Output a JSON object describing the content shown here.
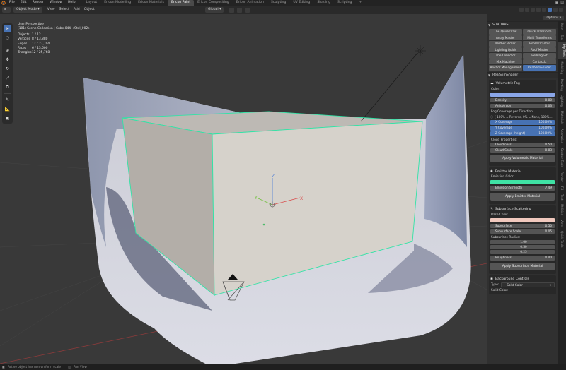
{
  "top_menu": [
    "File",
    "Edit",
    "Render",
    "Window",
    "Help"
  ],
  "workspace_tabs": [
    {
      "label": "Layout",
      "active": false
    },
    {
      "label": "Ericon Modelling",
      "active": false
    },
    {
      "label": "Ericon Materials",
      "active": false
    },
    {
      "label": "Ericon Paint",
      "active": true
    },
    {
      "label": "Ericon Compositing",
      "active": false
    },
    {
      "label": "Ericon Animation",
      "active": false
    },
    {
      "label": "Sculpting",
      "active": false
    },
    {
      "label": "UV Editing",
      "active": false
    },
    {
      "label": "Shading",
      "active": false
    },
    {
      "label": "Scripting",
      "active": false
    },
    {
      "label": "+",
      "active": false
    }
  ],
  "header": {
    "mode": "Object Mode",
    "menus": [
      "View",
      "Select",
      "Add",
      "Object"
    ],
    "transform_orientation": "Global",
    "options": "Options"
  },
  "viewport_overlay": {
    "view": "User Perspective",
    "collection": "(101) Scene Collection | Cube.044 <Stel_002>",
    "stats": [
      {
        "k": "Objects",
        "v": "1 / 12"
      },
      {
        "k": "Vertices",
        "v": "8 / 13,880"
      },
      {
        "k": "Edges",
        "v": "12 / 27,704"
      },
      {
        "k": "Faces",
        "v": "6 / 13,600"
      },
      {
        "k": "Triangles",
        "v": "12 / 25,768"
      }
    ],
    "gizmo_axes": {
      "z": "Z",
      "y": "Y",
      "x": "X"
    }
  },
  "tools": [
    "cursor",
    "select-box",
    "cursor-3d",
    "move",
    "rotate",
    "scale",
    "transform",
    "annotate",
    "measure",
    "add-cube"
  ],
  "sub_tabs": {
    "title": "SUB TABS",
    "buttons": [
      {
        "label": "The QuickDraw",
        "active": false
      },
      {
        "label": "Quick Transform",
        "active": false
      },
      {
        "label": "Array Master",
        "active": false
      },
      {
        "label": "Multi Transforms",
        "active": false
      },
      {
        "label": "Mother Picker",
        "active": false
      },
      {
        "label": "BoolsIDcanfor",
        "active": false
      },
      {
        "label": "Lighting Quick",
        "active": false
      },
      {
        "label": "Roof Master",
        "active": false
      },
      {
        "label": "The Collector",
        "active": false
      },
      {
        "label": "RefMagnet",
        "active": false
      },
      {
        "label": "Mix Machine",
        "active": false
      },
      {
        "label": "Cantactic",
        "active": false
      },
      {
        "label": "Anchor Management",
        "active": false
      },
      {
        "label": "RealSlimShader",
        "active": true
      }
    ]
  },
  "real_slim_shader": {
    "title": "RealSlimShader",
    "volumetric_fog": {
      "title": "Volumetric Fog",
      "color_label": "Color:",
      "color": "#8aa6e8",
      "fields": [
        {
          "label": "Density",
          "value": "0.80"
        },
        {
          "label": "Anisotropy",
          "value": "0.03"
        }
      ],
      "coverage_label": "Fog Coverage per Direction:",
      "coverage_note": "(-100% = Reverse, 0% = None, 100% ...",
      "coverage": [
        {
          "label": "X Coverage",
          "value": "100.00%"
        },
        {
          "label": "Y Coverage",
          "value": "100.00%"
        },
        {
          "label": "Z Coverage (height)",
          "value": "100.00%"
        }
      ],
      "cloud_label": "Cloud Properties:",
      "cloud": [
        {
          "label": "Cloudiness",
          "value": "0.50"
        },
        {
          "label": "Cloud Scale",
          "value": "0.83"
        }
      ],
      "apply": "Apply Volumetric Material"
    },
    "emitter": {
      "title": "Emitter Material",
      "color_label": "Emission Color:",
      "color": "#3fe2a4",
      "strength_label": "Emission Strength",
      "strength": "7.49",
      "apply": "Apply Emitter Material"
    },
    "subsurface": {
      "title": "Subsurface Scattering",
      "base_label": "Base Color:",
      "color": "#f0c8bd",
      "fields": [
        {
          "label": "Subsurface",
          "value": "0.50"
        },
        {
          "label": "Subsurface Scale",
          "value": "0.05"
        }
      ],
      "radius_label": "Subsurface Radius:",
      "radius": [
        "1.00",
        "0.50",
        "0.25"
      ],
      "roughness_label": "Roughness",
      "roughness": "0.40",
      "apply": "Apply Subsurface Material"
    },
    "background": {
      "title": "Background Controls",
      "type_label": "Type:",
      "type_value": "Solid Color",
      "solid_label": "Solid Color:"
    }
  },
  "vertical_tabs": [
    {
      "label": "Item",
      "active": false
    },
    {
      "label": "Tool",
      "active": false
    },
    {
      "label": "My Tools",
      "active": true
    },
    {
      "label": "Modeling",
      "active": false
    },
    {
      "label": "Painting",
      "active": false
    },
    {
      "label": "Lighting",
      "active": false
    },
    {
      "label": "Materials",
      "active": false
    },
    {
      "label": "Animation",
      "active": false
    },
    {
      "label": "Scatter Tools",
      "active": false
    },
    {
      "label": "Render",
      "active": false
    },
    {
      "label": "FX",
      "active": false
    },
    {
      "label": "Text",
      "active": false
    },
    {
      "label": "Utilities",
      "active": false
    },
    {
      "label": "View",
      "active": false
    },
    {
      "label": "Quick Tools",
      "active": false
    }
  ],
  "status": {
    "left": "Active object has non-uniform scale",
    "mid": "Pan View"
  }
}
